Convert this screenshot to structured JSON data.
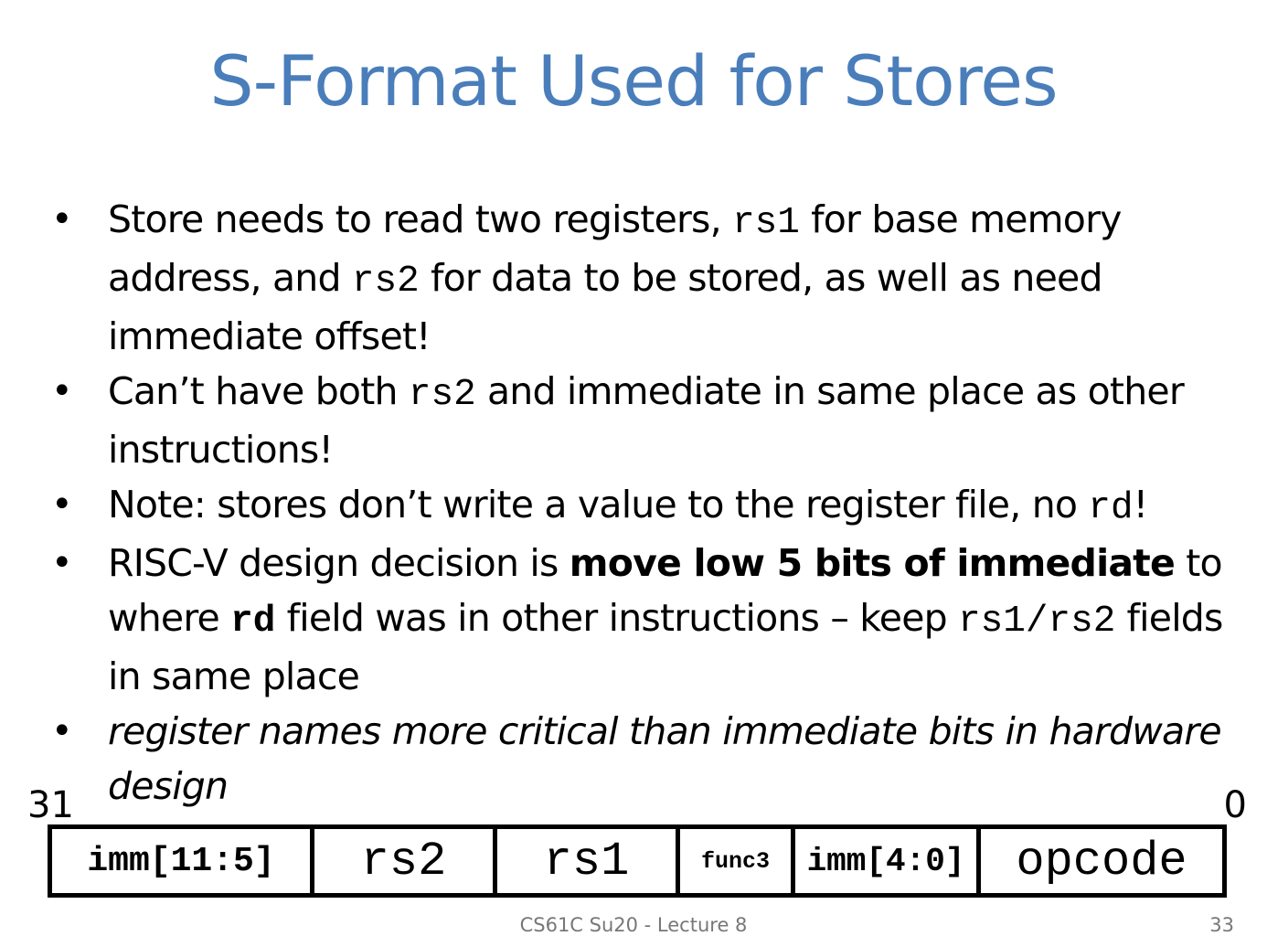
{
  "slide": {
    "title": "S-Format Used for Stores",
    "bullets": [
      {
        "parts": [
          {
            "text": "Store needs to read two registers, ",
            "style": "normal"
          },
          {
            "text": "rs1",
            "style": "mono"
          },
          {
            "text": " for base memory address, and ",
            "style": "normal"
          },
          {
            "text": "rs2",
            "style": "mono"
          },
          {
            "text": " for data to be stored, as well as need immediate offset!",
            "style": "normal"
          }
        ]
      },
      {
        "parts": [
          {
            "text": "Can’t have both ",
            "style": "normal"
          },
          {
            "text": "rs2",
            "style": "mono"
          },
          {
            "text": " and immediate in same place as other instructions!",
            "style": "normal"
          }
        ]
      },
      {
        "parts": [
          {
            "text": "Note: stores don’t write a value to the register file, no ",
            "style": "normal"
          },
          {
            "text": "rd",
            "style": "mono"
          },
          {
            "text": "!",
            "style": "normal"
          }
        ]
      },
      {
        "parts": [
          {
            "text": "RISC-V design decision is ",
            "style": "normal"
          },
          {
            "text": "move low 5 bits of immediate",
            "style": "bold"
          },
          {
            "text": " to where ",
            "style": "normal"
          },
          {
            "text": "rd",
            "style": "mono-bold"
          },
          {
            "text": " field was in other instructions – keep ",
            "style": "normal"
          },
          {
            "text": "rs1/rs2",
            "style": "mono"
          },
          {
            "text": " fields in same place",
            "style": "normal"
          }
        ]
      },
      {
        "parts": [
          {
            "text": "register names more critical than immediate bits in hardware design",
            "style": "italic"
          }
        ]
      }
    ],
    "bit_high": "31",
    "bit_low": "0",
    "fields": [
      {
        "label": "imm[11:5]",
        "bold": true
      },
      {
        "label": "rs2",
        "bold": false
      },
      {
        "label": "rs1",
        "bold": false
      },
      {
        "label": "func3",
        "bold": true
      },
      {
        "label": "imm[4:0]",
        "bold": true
      },
      {
        "label": "opcode",
        "bold": false
      }
    ],
    "footer": "CS61C Su20 - Lecture 8",
    "page_number": "33"
  }
}
